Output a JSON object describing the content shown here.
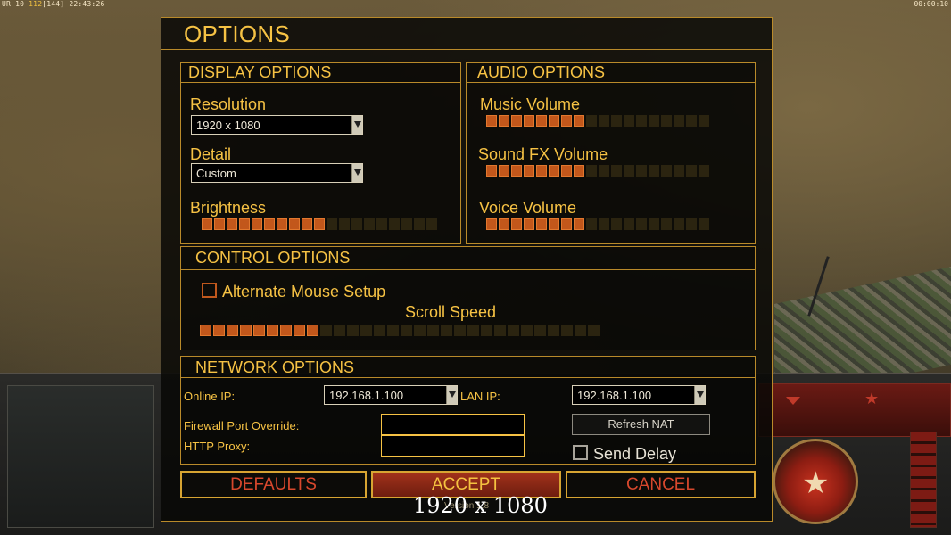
{
  "hud": {
    "left_prefix": "UR",
    "left_num1": "10",
    "left_num2": "112",
    "left_num3": "[144]",
    "left_time": "22:43:26",
    "right_time": "00:00:10"
  },
  "window": {
    "title": "OPTIONS"
  },
  "display": {
    "title": "DISPLAY OPTIONS",
    "resolution_label": "Resolution",
    "resolution_value": "1920 x 1080",
    "detail_label": "Detail",
    "detail_value": "Custom",
    "brightness_label": "Brightness",
    "brightness_level": 0.53
  },
  "audio": {
    "title": "AUDIO OPTIONS",
    "music_label": "Music Volume",
    "music_level": 0.44,
    "sfx_label": "Sound FX Volume",
    "sfx_level": 0.44,
    "voice_label": "Voice Volume",
    "voice_level": 0.44
  },
  "control": {
    "title": "CONTROL OPTIONS",
    "alt_mouse_label": "Alternate Mouse Setup",
    "alt_mouse_checked": false,
    "scroll_speed_label": "Scroll Speed",
    "scroll_speed_level": 0.3
  },
  "network": {
    "title": "NETWORK OPTIONS",
    "online_ip_label": "Online IP:",
    "online_ip_value": "192.168.1.100",
    "lan_ip_label": "LAN IP:",
    "lan_ip_value": "192.168.1.100",
    "firewall_label": "Firewall Port Override:",
    "firewall_value": "",
    "http_proxy_label": "HTTP Proxy:",
    "http_proxy_value": "",
    "refresh_nat_label": "Refresh NAT",
    "send_delay_label": "Send Delay",
    "send_delay_checked": false
  },
  "buttons": {
    "defaults": "DEFAULTS",
    "accept": "ACCEPT",
    "cancel": "CANCEL"
  },
  "version_text": "Version 1.8",
  "overlay_resolution": "1920 x 1080",
  "colors": {
    "accent_gold": "#f6c244",
    "slider_on": "#c2571b",
    "slider_off": "#2b2410",
    "button_text_red": "#d8482d"
  }
}
